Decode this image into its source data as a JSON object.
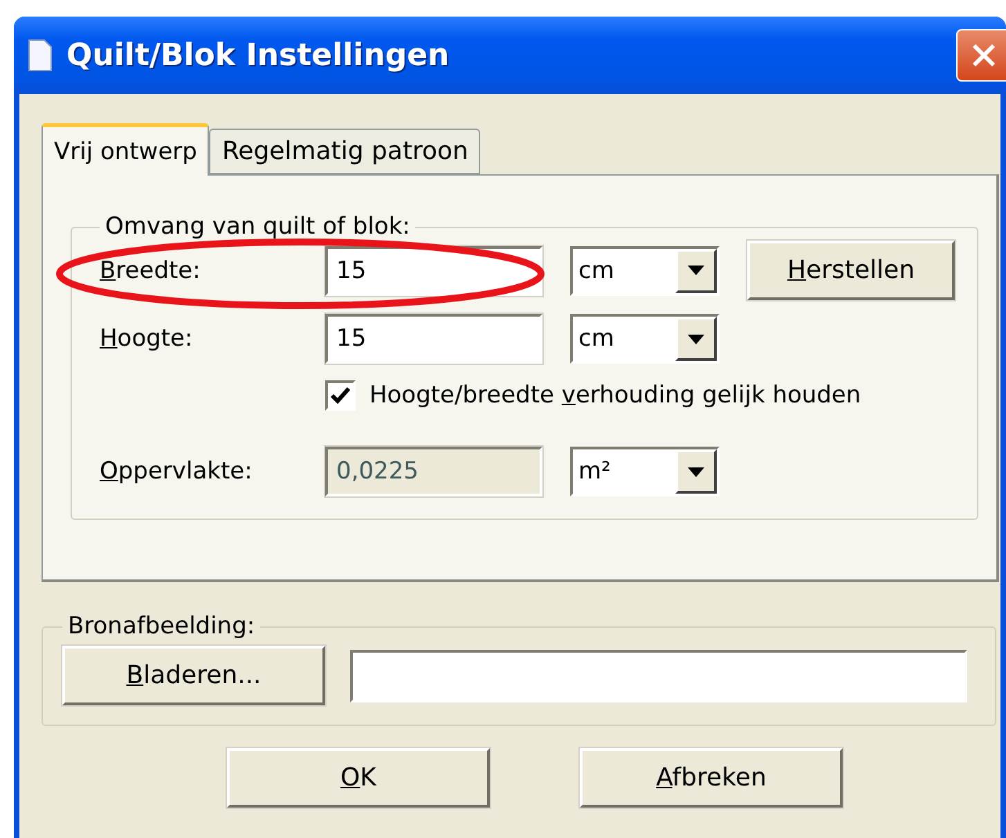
{
  "window": {
    "title": "Quilt/Blok Instellingen"
  },
  "tabs": [
    {
      "label": "Vrij ontwerp",
      "selected": true
    },
    {
      "label": "Regelmatig patroon",
      "selected": false
    }
  ],
  "size_group": {
    "title": "Omvang van quilt of blok:",
    "rows": [
      {
        "kind": "field",
        "label": {
          "key": "B",
          "post": "reedte:"
        },
        "value": "15",
        "unit": "cm",
        "circled": true,
        "disabled": false,
        "button": {
          "key": "H",
          "post": "erstellen"
        }
      },
      {
        "kind": "field",
        "label": {
          "key": "H",
          "post": "oogte:"
        },
        "value": "15",
        "unit": "cm",
        "disabled": false
      },
      {
        "kind": "checkbox",
        "label": {
          "pre": "Hoogte/breedte ",
          "key": "v",
          "post": "erhouding gelijk houden"
        },
        "checked": true
      },
      {
        "kind": "field",
        "label": {
          "key": "O",
          "post": "ppervlakte:"
        },
        "value": "0,0225",
        "unit": "m²",
        "disabled": true
      }
    ]
  },
  "source_group": {
    "title": "Bronafbeelding:",
    "button": {
      "key": "B",
      "post": "laderen..."
    }
  },
  "buttons": [
    {
      "key": "O",
      "post": "K"
    },
    {
      "key": "A",
      "post": "fbreken"
    }
  ]
}
